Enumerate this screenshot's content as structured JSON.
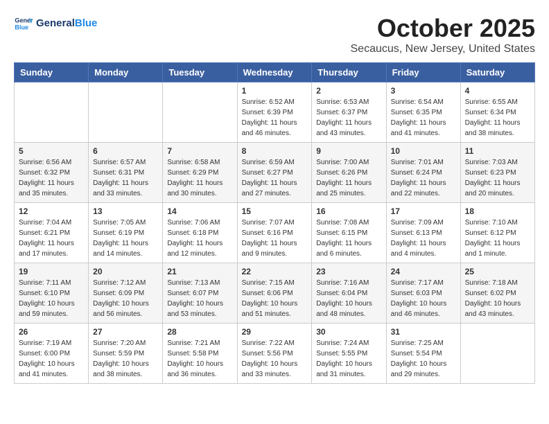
{
  "header": {
    "logo_line1": "General",
    "logo_line2": "Blue",
    "month": "October 2025",
    "location": "Secaucus, New Jersey, United States"
  },
  "days_of_week": [
    "Sunday",
    "Monday",
    "Tuesday",
    "Wednesday",
    "Thursday",
    "Friday",
    "Saturday"
  ],
  "weeks": [
    [
      {
        "day": "",
        "info": ""
      },
      {
        "day": "",
        "info": ""
      },
      {
        "day": "",
        "info": ""
      },
      {
        "day": "1",
        "info": "Sunrise: 6:52 AM\nSunset: 6:39 PM\nDaylight: 11 hours\nand 46 minutes."
      },
      {
        "day": "2",
        "info": "Sunrise: 6:53 AM\nSunset: 6:37 PM\nDaylight: 11 hours\nand 43 minutes."
      },
      {
        "day": "3",
        "info": "Sunrise: 6:54 AM\nSunset: 6:35 PM\nDaylight: 11 hours\nand 41 minutes."
      },
      {
        "day": "4",
        "info": "Sunrise: 6:55 AM\nSunset: 6:34 PM\nDaylight: 11 hours\nand 38 minutes."
      }
    ],
    [
      {
        "day": "5",
        "info": "Sunrise: 6:56 AM\nSunset: 6:32 PM\nDaylight: 11 hours\nand 35 minutes."
      },
      {
        "day": "6",
        "info": "Sunrise: 6:57 AM\nSunset: 6:31 PM\nDaylight: 11 hours\nand 33 minutes."
      },
      {
        "day": "7",
        "info": "Sunrise: 6:58 AM\nSunset: 6:29 PM\nDaylight: 11 hours\nand 30 minutes."
      },
      {
        "day": "8",
        "info": "Sunrise: 6:59 AM\nSunset: 6:27 PM\nDaylight: 11 hours\nand 27 minutes."
      },
      {
        "day": "9",
        "info": "Sunrise: 7:00 AM\nSunset: 6:26 PM\nDaylight: 11 hours\nand 25 minutes."
      },
      {
        "day": "10",
        "info": "Sunrise: 7:01 AM\nSunset: 6:24 PM\nDaylight: 11 hours\nand 22 minutes."
      },
      {
        "day": "11",
        "info": "Sunrise: 7:03 AM\nSunset: 6:23 PM\nDaylight: 11 hours\nand 20 minutes."
      }
    ],
    [
      {
        "day": "12",
        "info": "Sunrise: 7:04 AM\nSunset: 6:21 PM\nDaylight: 11 hours\nand 17 minutes."
      },
      {
        "day": "13",
        "info": "Sunrise: 7:05 AM\nSunset: 6:19 PM\nDaylight: 11 hours\nand 14 minutes."
      },
      {
        "day": "14",
        "info": "Sunrise: 7:06 AM\nSunset: 6:18 PM\nDaylight: 11 hours\nand 12 minutes."
      },
      {
        "day": "15",
        "info": "Sunrise: 7:07 AM\nSunset: 6:16 PM\nDaylight: 11 hours\nand 9 minutes."
      },
      {
        "day": "16",
        "info": "Sunrise: 7:08 AM\nSunset: 6:15 PM\nDaylight: 11 hours\nand 6 minutes."
      },
      {
        "day": "17",
        "info": "Sunrise: 7:09 AM\nSunset: 6:13 PM\nDaylight: 11 hours\nand 4 minutes."
      },
      {
        "day": "18",
        "info": "Sunrise: 7:10 AM\nSunset: 6:12 PM\nDaylight: 11 hours\nand 1 minute."
      }
    ],
    [
      {
        "day": "19",
        "info": "Sunrise: 7:11 AM\nSunset: 6:10 PM\nDaylight: 10 hours\nand 59 minutes."
      },
      {
        "day": "20",
        "info": "Sunrise: 7:12 AM\nSunset: 6:09 PM\nDaylight: 10 hours\nand 56 minutes."
      },
      {
        "day": "21",
        "info": "Sunrise: 7:13 AM\nSunset: 6:07 PM\nDaylight: 10 hours\nand 53 minutes."
      },
      {
        "day": "22",
        "info": "Sunrise: 7:15 AM\nSunset: 6:06 PM\nDaylight: 10 hours\nand 51 minutes."
      },
      {
        "day": "23",
        "info": "Sunrise: 7:16 AM\nSunset: 6:04 PM\nDaylight: 10 hours\nand 48 minutes."
      },
      {
        "day": "24",
        "info": "Sunrise: 7:17 AM\nSunset: 6:03 PM\nDaylight: 10 hours\nand 46 minutes."
      },
      {
        "day": "25",
        "info": "Sunrise: 7:18 AM\nSunset: 6:02 PM\nDaylight: 10 hours\nand 43 minutes."
      }
    ],
    [
      {
        "day": "26",
        "info": "Sunrise: 7:19 AM\nSunset: 6:00 PM\nDaylight: 10 hours\nand 41 minutes."
      },
      {
        "day": "27",
        "info": "Sunrise: 7:20 AM\nSunset: 5:59 PM\nDaylight: 10 hours\nand 38 minutes."
      },
      {
        "day": "28",
        "info": "Sunrise: 7:21 AM\nSunset: 5:58 PM\nDaylight: 10 hours\nand 36 minutes."
      },
      {
        "day": "29",
        "info": "Sunrise: 7:22 AM\nSunset: 5:56 PM\nDaylight: 10 hours\nand 33 minutes."
      },
      {
        "day": "30",
        "info": "Sunrise: 7:24 AM\nSunset: 5:55 PM\nDaylight: 10 hours\nand 31 minutes."
      },
      {
        "day": "31",
        "info": "Sunrise: 7:25 AM\nSunset: 5:54 PM\nDaylight: 10 hours\nand 29 minutes."
      },
      {
        "day": "",
        "info": ""
      }
    ]
  ]
}
